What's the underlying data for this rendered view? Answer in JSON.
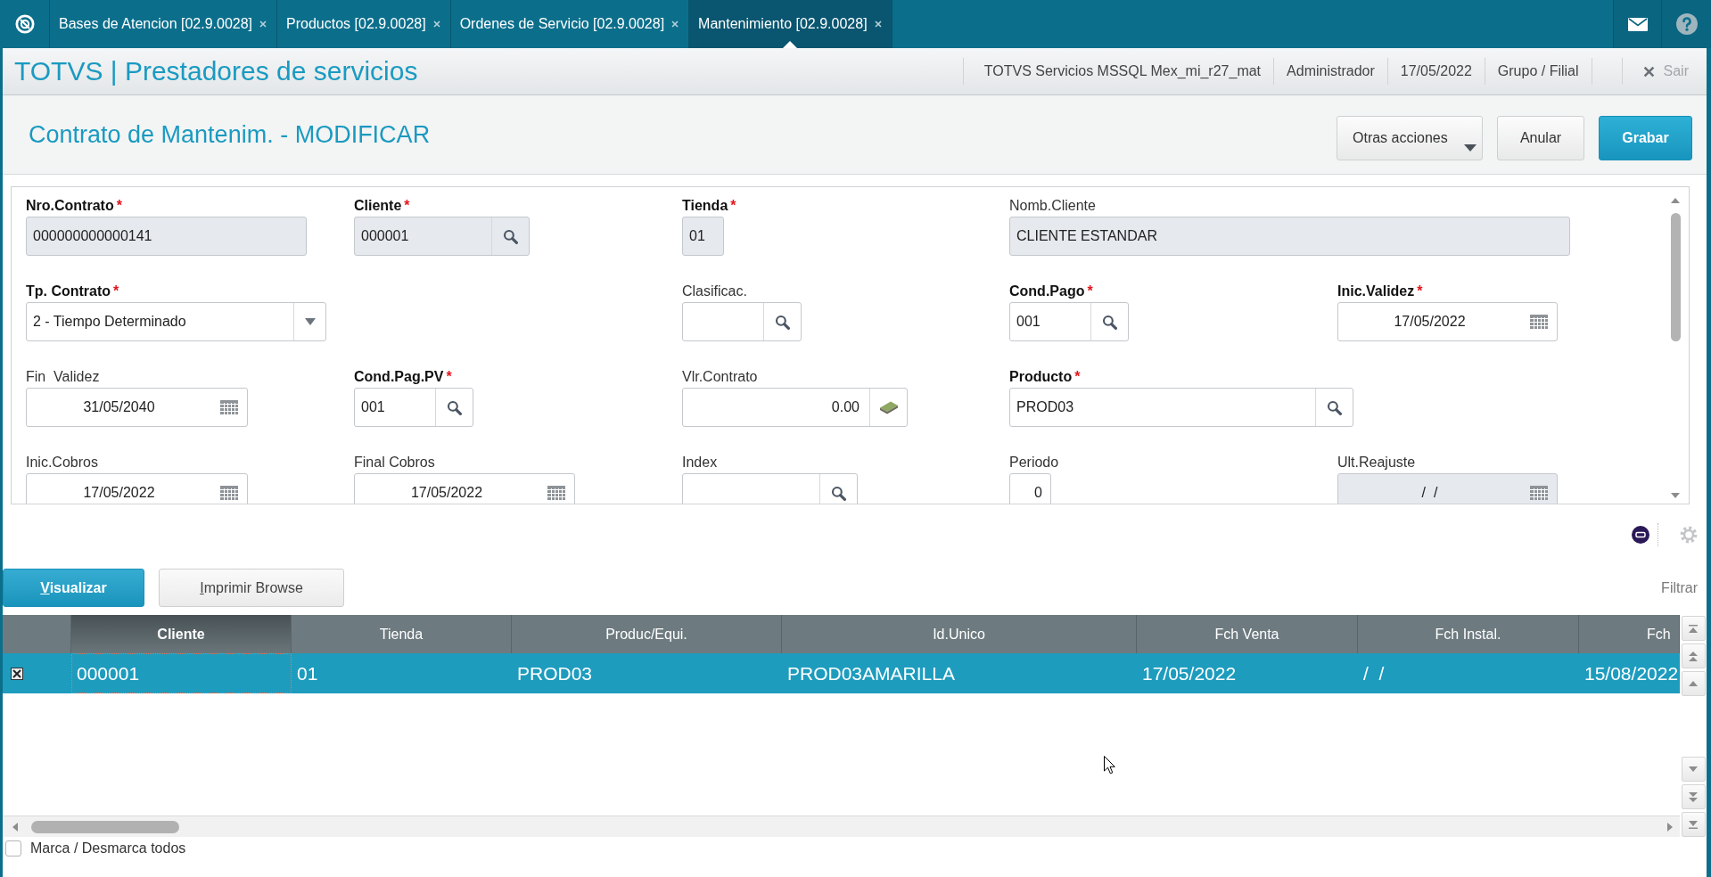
{
  "tab_bar": {
    "tabs": [
      {
        "label": "Bases de Atencion [02.9.0028]",
        "selected": false
      },
      {
        "label": "Productos [02.9.0028]",
        "selected": false
      },
      {
        "label": "Ordenes de Servicio [02.9.0028]",
        "selected": false
      },
      {
        "label": "Mantenimiento [02.9.0028]",
        "selected": true
      }
    ]
  },
  "header": {
    "title": "TOTVS | Prestadores de servicios",
    "info": [
      "TOTVS Servicios MSSQL Mex_mi_r27_mat",
      "Administrador",
      "17/05/2022",
      "Grupo / Filial"
    ],
    "exit": {
      "label": "Sair"
    }
  },
  "form": {
    "title": "Contrato de Mantenim. - MODIFICAR",
    "actions": [
      {
        "label": "Otras acciones",
        "kind": "menu"
      },
      {
        "label": "Anular",
        "kind": "secondary"
      },
      {
        "label": "Grabar",
        "kind": "primary"
      }
    ],
    "rows": [
      [
        {
          "label": "Nro.Contrato",
          "required": true,
          "required_mark": "*",
          "kind": "text",
          "value": "000000000000141",
          "disabled": true
        },
        {
          "label": "Cliente",
          "required": true,
          "required_mark": "*",
          "kind": "lookup",
          "value": "000001",
          "disabled": true
        },
        {
          "label": "Tienda",
          "required": true,
          "required_mark": "*",
          "kind": "text",
          "value": "01",
          "disabled": true
        },
        {
          "label": "Nomb.Cliente",
          "required": false,
          "kind": "text",
          "value": "CLIENTE ESTANDAR",
          "disabled": true
        }
      ],
      [
        {
          "label": "Tp. Contrato",
          "required": true,
          "required_mark": "*",
          "kind": "select",
          "value": "2 - Tiempo Determinado",
          "disabled": false
        },
        "",
        {
          "label": "Clasificac.",
          "required": false,
          "kind": "lookup",
          "disabled": false
        },
        {
          "label": "Cond.Pago",
          "required": true,
          "required_mark": "*",
          "kind": "lookup",
          "value": "001",
          "disabled": false
        },
        {
          "label": "Inic.Validez",
          "required": true,
          "required_mark": "*",
          "kind": "date",
          "value": "17/05/2022",
          "disabled": false
        }
      ],
      [
        {
          "label": "Fin  Validez",
          "required": false,
          "kind": "date",
          "value": "31/05/2040",
          "disabled": false
        },
        {
          "label": "Cond.Pag.PV",
          "required": true,
          "required_mark": "*",
          "kind": "lookup",
          "value": "001",
          "disabled": false
        },
        {
          "label": "Vlr.Contrato",
          "required": false,
          "kind": "currency",
          "value": "0.00",
          "disabled": false
        },
        {
          "label": "Producto",
          "required": true,
          "required_mark": "*",
          "kind": "lookup",
          "value": "PROD03",
          "disabled": false
        }
      ],
      [
        {
          "label": "Inic.Cobros",
          "required": false,
          "kind": "date",
          "value": "17/05/2022",
          "disabled": false
        },
        {
          "label": "Final Cobros",
          "required": false,
          "kind": "date",
          "value": "17/05/2022",
          "disabled": false
        },
        {
          "label": "Index",
          "required": false,
          "kind": "lookup",
          "disabled": false
        },
        {
          "label": "Periodo",
          "required": false,
          "kind": "number",
          "value": "0",
          "disabled": false
        },
        {
          "label": "Ult.Reajuste",
          "required": false,
          "kind": "date",
          "value": "/  /",
          "disabled": true
        }
      ]
    ]
  },
  "browse": {
    "buttons": [
      {
        "label": "Visualizar",
        "kind": "primary",
        "access_key_underlined": true
      },
      {
        "label": "Imprimir Browse",
        "kind": "secondary",
        "access_key_underlined": true
      }
    ],
    "filter_label": "Filtrar",
    "table": {
      "columns": [
        {
          "label": "Cliente",
          "selected": true
        },
        {
          "label": "Tienda",
          "selected": false
        },
        {
          "label": "Produc/Equi.",
          "selected": false
        },
        {
          "label": "Id.Unico",
          "selected": false
        },
        {
          "label": "Fch Venta",
          "selected": false
        },
        {
          "label": "Fch Instal.",
          "selected": false
        },
        {
          "label": "Fch",
          "selected": false
        }
      ],
      "rows": [
        {
          "checked": true,
          "selected": true,
          "cells": [
            "000001",
            "01",
            "PROD03",
            "PROD03AMARILLA",
            "17/05/2022",
            "/  /",
            "15/08/2022"
          ]
        }
      ]
    },
    "select_all": {
      "label": "Marca / Desmarca todos",
      "checked": false
    }
  }
}
